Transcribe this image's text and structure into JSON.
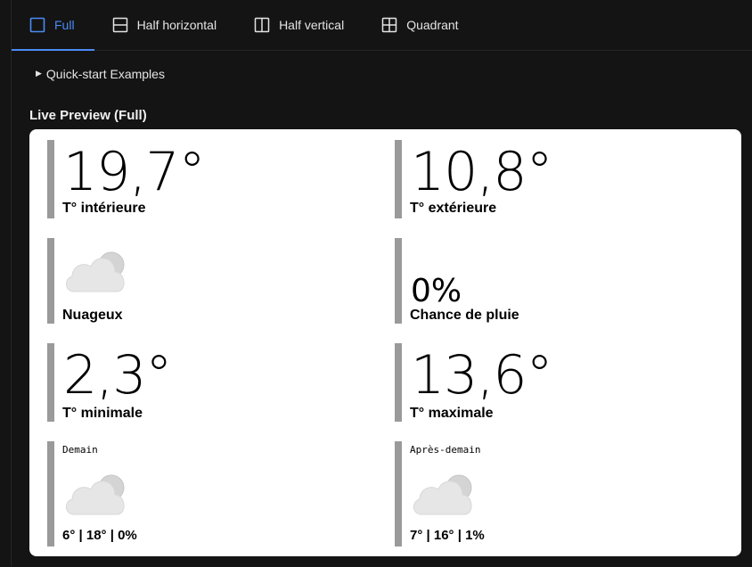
{
  "tabs": [
    {
      "label": "Full",
      "icon": "square-icon",
      "active": true
    },
    {
      "label": "Half horizontal",
      "icon": "half-horizontal-icon",
      "active": false
    },
    {
      "label": "Half vertical",
      "icon": "half-vertical-icon",
      "active": false
    },
    {
      "label": "Quadrant",
      "icon": "quadrant-icon",
      "active": false
    }
  ],
  "quickstart": {
    "label": "Quick-start Examples"
  },
  "preview": {
    "title": "Live Preview (Full)",
    "indoor": {
      "value": "19,7°",
      "label": "T° intérieure"
    },
    "outdoor": {
      "value": "10,8°",
      "label": "T° extérieure"
    },
    "condition": {
      "icon": "cloudy-icon",
      "label": "Nuageux"
    },
    "rain": {
      "value": "0%",
      "label": "Chance de pluie"
    },
    "min": {
      "value": "2,3°",
      "label": "T° minimale"
    },
    "max": {
      "value": "13,6°",
      "label": "T° maximale"
    },
    "tomorrow": {
      "title": "Demain",
      "icon": "cloudy-icon",
      "summary": "6° | 18° | 0%"
    },
    "after_tomorrow": {
      "title": "Après-demain",
      "icon": "cloudy-icon",
      "summary": "7° | 16° | 1%"
    }
  },
  "colors": {
    "background": "#141414",
    "accent": "#4b8bf5",
    "card": "#ffffff"
  }
}
